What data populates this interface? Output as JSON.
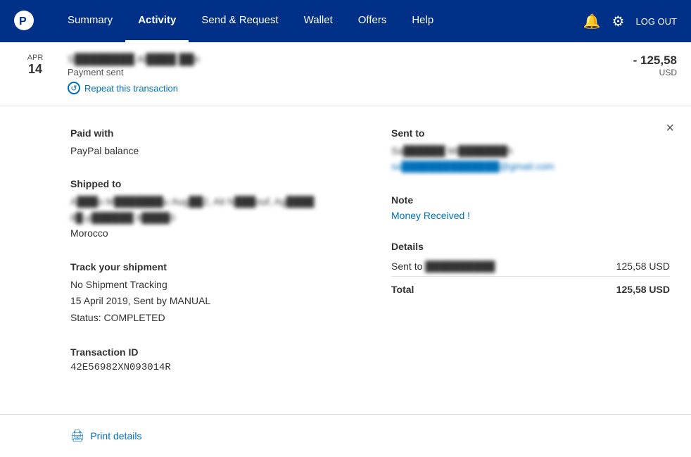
{
  "header": {
    "logo_alt": "PayPal",
    "nav": [
      {
        "label": "Summary",
        "active": false
      },
      {
        "label": "Activity",
        "active": true
      },
      {
        "label": "Send & Request",
        "active": false
      },
      {
        "label": "Wallet",
        "active": false
      },
      {
        "label": "Offers",
        "active": false
      },
      {
        "label": "Help",
        "active": false
      }
    ],
    "logout_label": "LOG OUT"
  },
  "transaction": {
    "date_month": "APR",
    "date_day": "14",
    "name_blurred": "S████████ Al████ ██n",
    "status": "Payment sent",
    "repeat_label": "Repeat this transaction",
    "amount": "- 125,58",
    "currency": "USD"
  },
  "detail": {
    "close_label": "×",
    "paid_with_title": "Paid with",
    "paid_with_value": "PayPal balance",
    "shipped_to_title": "Shipped to",
    "shipped_to_line1": "A███o M███████u",
    "shipped_to_line2": "Aug██2, Ait N███ouf, Ag████",
    "shipped_to_line3": "8█-p██████",
    "shipped_to_line4": "8████0",
    "shipped_to_line5": "Morocco",
    "sent_to_title": "Sent to",
    "sent_to_name_blurred": "Sa██████ Mi███████h",
    "sent_to_email_blurred": "sa██████████████@gmail.com",
    "note_title": "Note",
    "note_value": "Money Received !",
    "details_title": "Details",
    "details_row_label": "Sent to ██████████",
    "details_row_amount": "125,58 USD",
    "total_label": "Total",
    "total_amount": "125,58 USD",
    "track_title": "Track your shipment",
    "track_line1": "No Shipment Tracking",
    "track_line2": "15 April 2019, Sent by MANUAL",
    "track_line3": "Status: COMPLETED",
    "txn_title": "Transaction ID",
    "txn_id": "42E56982XN093014R",
    "print_label": "Print details"
  }
}
